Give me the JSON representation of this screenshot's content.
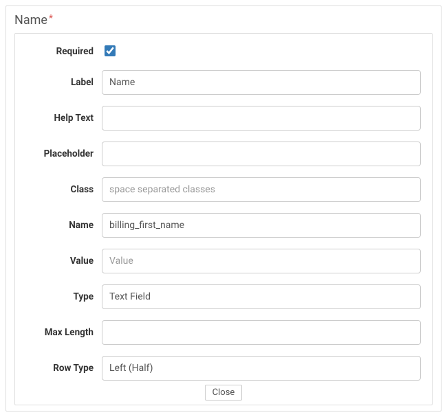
{
  "panel": {
    "title": "Name",
    "required_marker": "*"
  },
  "form": {
    "required": {
      "label": "Required",
      "checked": true
    },
    "label": {
      "label": "Label",
      "value": "Name",
      "placeholder": ""
    },
    "help_text": {
      "label": "Help Text",
      "value": "",
      "placeholder": ""
    },
    "placeholder": {
      "label": "Placeholder",
      "value": "",
      "placeholder": ""
    },
    "class": {
      "label": "Class",
      "value": "",
      "placeholder": "space separated classes"
    },
    "name": {
      "label": "Name",
      "value": "billing_first_name",
      "placeholder": ""
    },
    "value": {
      "label": "Value",
      "value": "",
      "placeholder": "Value"
    },
    "type": {
      "label": "Type",
      "value": "Text Field",
      "placeholder": ""
    },
    "max_length": {
      "label": "Max Length",
      "value": "",
      "placeholder": ""
    },
    "row_type": {
      "label": "Row Type",
      "value": "Left (Half)",
      "placeholder": ""
    }
  },
  "actions": {
    "close": "Close"
  }
}
